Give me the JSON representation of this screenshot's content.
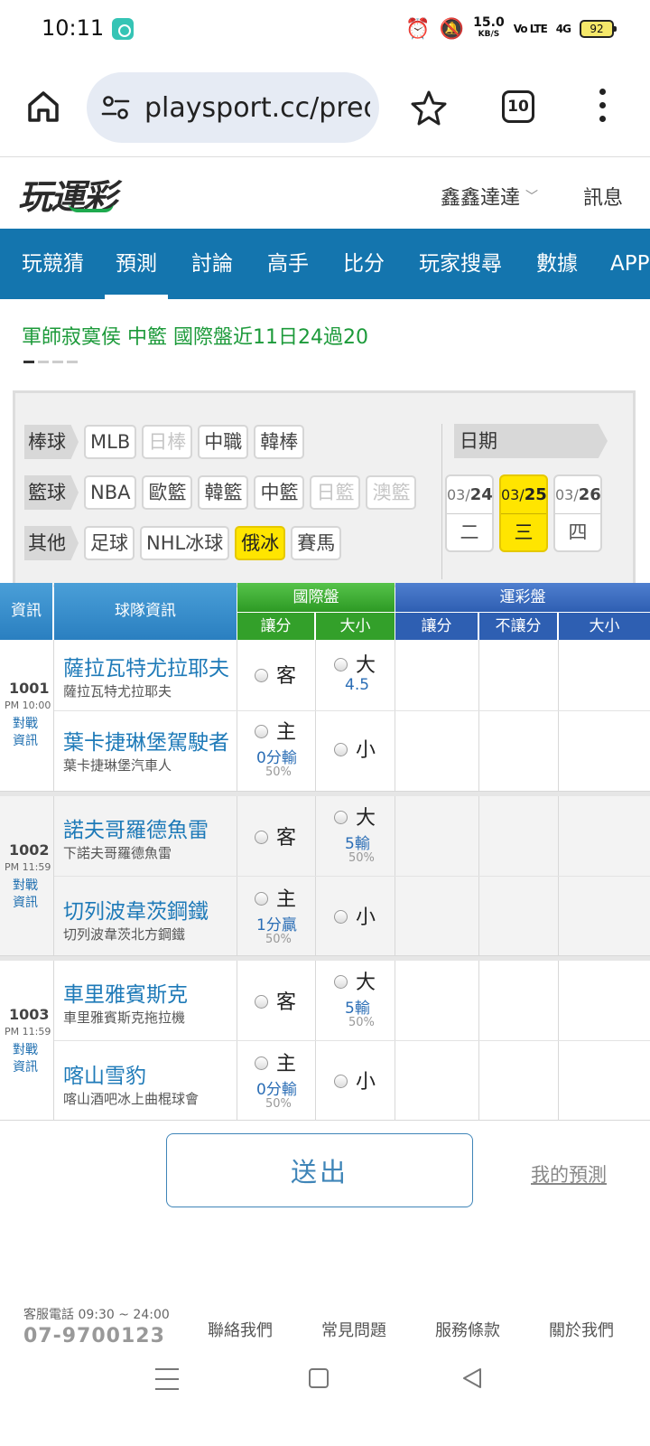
{
  "status_bar": {
    "time": "10:11",
    "speed_value": "15.0",
    "speed_unit": "KB/S",
    "volte": "Vo LTE",
    "network": "4G",
    "battery": "92"
  },
  "browser": {
    "url": "playsport.cc/pred",
    "tab_count": "10"
  },
  "site": {
    "logo": "玩運彩",
    "user_name": "鑫鑫達達",
    "messages": "訊息"
  },
  "nav": {
    "items": [
      "玩競猜",
      "預測",
      "討論",
      "高手",
      "比分",
      "玩家搜尋",
      "數據",
      "APP"
    ],
    "active_index": 1
  },
  "ticker": {
    "text": "軍師寂寞侯 中籃 國際盤近11日24過20"
  },
  "filters": {
    "baseball": {
      "label": "棒球",
      "items": [
        "MLB",
        "日棒",
        "中職",
        "韓棒"
      ]
    },
    "basketball": {
      "label": "籃球",
      "items": [
        "NBA",
        "歐籃",
        "韓籃",
        "中籃",
        "日籃",
        "澳籃"
      ]
    },
    "other": {
      "label": "其他",
      "items": [
        "足球",
        "NHL冰球",
        "俄冰",
        "賽馬"
      ]
    },
    "date_label": "日期",
    "dates": [
      {
        "month": "03/",
        "day": "24",
        "weekday": "二"
      },
      {
        "month": "03/",
        "day": "25",
        "weekday": "三"
      },
      {
        "month": "03/",
        "day": "26",
        "weekday": "四"
      }
    ]
  },
  "table": {
    "headers": {
      "info": "資訊",
      "team": "球隊資訊",
      "intl": "國際盤",
      "intl_spread": "讓分",
      "intl_total": "大小",
      "sport": "運彩盤",
      "sport_spread": "讓分",
      "sport_nospread": "不讓分",
      "sport_total": "大小"
    },
    "matches": [
      {
        "id": "1001",
        "time": "PM 10:00",
        "link": "對戰資訊",
        "away_name": "薩拉瓦特尤拉耶夫",
        "away_sub": "薩拉瓦特尤拉耶夫",
        "home_name": "葉卡捷琳堡駕駛者",
        "home_sub": "葉卡捷琳堡汽車人",
        "away_label": "客",
        "home_label": "主",
        "spread_value": "0分輸",
        "spread_pct": "50%",
        "over_label": "大",
        "under_label": "小",
        "total_value": "4.5",
        "total_pct": ""
      },
      {
        "id": "1002",
        "time": "PM 11:59",
        "link": "對戰資訊",
        "away_name": "諾夫哥羅德魚雷",
        "away_sub": "下諾夫哥羅德魚雷",
        "home_name": "切列波韋茨鋼鐵",
        "home_sub": "切列波韋茨北方鋼鐵",
        "away_label": "客",
        "home_label": "主",
        "spread_value": "1分贏",
        "spread_pct": "50%",
        "over_label": "大",
        "under_label": "小",
        "total_value": "5輸",
        "total_pct": "50%"
      },
      {
        "id": "1003",
        "time": "PM 11:59",
        "link": "對戰資訊",
        "away_name": "車里雅賓斯克",
        "away_sub": "車里雅賓斯克拖拉機",
        "home_name": "喀山雪豹",
        "home_sub": "喀山酒吧冰上曲棍球會",
        "away_label": "客",
        "home_label": "主",
        "spread_value": "0分輸",
        "spread_pct": "50%",
        "over_label": "大",
        "under_label": "小",
        "total_value": "5輸",
        "total_pct": "50%"
      }
    ]
  },
  "actions": {
    "submit": "送出",
    "my_predictions": "我的預測"
  },
  "footer": {
    "hotline": "客服電話 09:30 ~ 24:00",
    "phone": "07-9700123",
    "links": [
      "聯絡我們",
      "常見問題",
      "服務條款",
      "關於我們"
    ]
  },
  "colors": {
    "nav_blue": "#1475ae",
    "ticker_green": "#1c9a3a",
    "active_yellow": "#ffe500",
    "intl_header_green": "#33a02a",
    "sport_header_blue": "#2e5fb2",
    "team_link_blue": "#1e7ab8"
  }
}
